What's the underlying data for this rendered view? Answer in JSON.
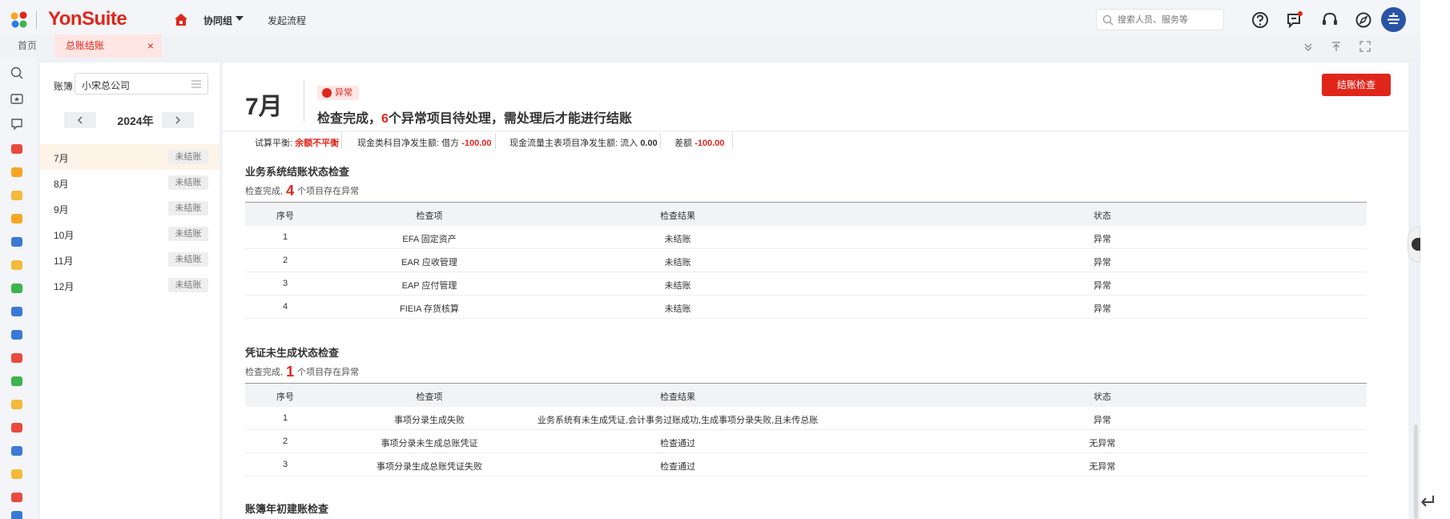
{
  "topbar": {
    "brand": "YonSuite",
    "collab_label": "协同组",
    "launch_label": "发起流程",
    "search_placeholder": "搜索人员、服务等",
    "avatar_initial": ""
  },
  "tabs": {
    "home": "首页",
    "active": "总账结账",
    "close": "×"
  },
  "month_panel": {
    "ledger_label": "账簿",
    "ledger_value": "小宋总公司",
    "year": "2024年",
    "months": [
      {
        "name": "7月",
        "status": "未结账"
      },
      {
        "name": "8月",
        "status": "未结账"
      },
      {
        "name": "9月",
        "status": "未结账"
      },
      {
        "name": "10月",
        "status": "未结账"
      },
      {
        "name": "11月",
        "status": "未结账"
      },
      {
        "name": "12月",
        "status": "未结账"
      }
    ]
  },
  "header": {
    "month": "7月",
    "status": "异常",
    "headline_prefix": "检查完成，",
    "headline_count": "6",
    "headline_suffix": "个异常项目待处理，需处理后才能进行结账",
    "check_button": "结账检查"
  },
  "summary": {
    "trial_label": "试算平衡:",
    "trial_value": "余额不平衡",
    "cash_label": "现金类科目净发生额: 借方",
    "cash_value": "-100.00",
    "flow_label": "现金流量主表项目净发生额: 流入",
    "flow_value": "0.00",
    "diff_label": "差额",
    "diff_value": "-100.00"
  },
  "sections": [
    {
      "title": "业务系统结账状态检查",
      "sub_prefix": "检查完成,",
      "count": "4",
      "sub_suffix": "个项目存在异常",
      "columns": [
        "序号",
        "检查项",
        "检查结果",
        "状态"
      ],
      "rows": [
        [
          "1",
          "EFA 固定资产",
          "未结账",
          "异常"
        ],
        [
          "2",
          "EAR 应收管理",
          "未结账",
          "异常"
        ],
        [
          "3",
          "EAP 应付管理",
          "未结账",
          "异常"
        ],
        [
          "4",
          "FIEIA 存货核算",
          "未结账",
          "异常"
        ]
      ]
    },
    {
      "title": "凭证未生成状态检查",
      "sub_prefix": "检查完成,",
      "count": "1",
      "sub_suffix": "个项目存在异常",
      "columns": [
        "序号",
        "检查项",
        "检查结果",
        "状态"
      ],
      "rows": [
        [
          "1",
          "事项分录生成失败",
          "业务系统有未生成凭证,会计事务过账成功,生成事项分录失败,且未传总账",
          "异常"
        ],
        [
          "2",
          "事项分录未生成总账凭证",
          "检查通过",
          "无异常"
        ],
        [
          "3",
          "事项分录生成总账凭证失败",
          "检查通过",
          "无异常"
        ]
      ]
    },
    {
      "title": "账簿年初建账检查"
    }
  ],
  "colors": {
    "accent": "#e0261b",
    "selected_month_bg": "#fdf3e6",
    "avatar": "#2954a6"
  }
}
